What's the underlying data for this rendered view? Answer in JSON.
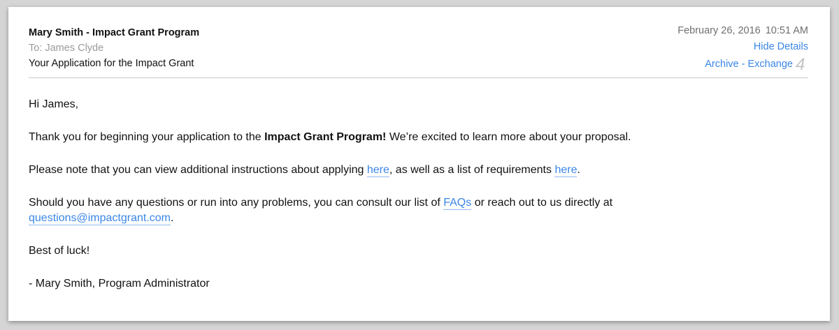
{
  "header": {
    "sender": "Mary Smith - Impact Grant Program",
    "to": "To: James Clyde",
    "subject": "Your Application for the Impact Grant",
    "date": "February 26, 2016",
    "time": "10:51 AM",
    "hide_details": "Hide Details",
    "mailbox": "Archive - Exchange",
    "count": "4"
  },
  "body": {
    "greeting": "Hi James,",
    "p1_pre": "Thank you for beginning your application to the ",
    "p1_bold": "Impact Grant Program!",
    "p1_post": " We’re excited to learn more about your proposal.",
    "p2_pre": "Please note that you can view additional instructions about applying ",
    "p2_link1": "here",
    "p2_mid": ", as well as a list of requirements ",
    "p2_link2": "here",
    "p2_post": ".",
    "p3_pre": "Should you have any questions or run into any problems, you can consult our list of ",
    "p3_link_faq": "FAQs",
    "p3_mid": " or reach out to us directly at",
    "p3_email": "questions@impactgrant.com",
    "p3_post": ".",
    "closing": "Best of luck!",
    "signature": "- Mary Smith, Program Administrator"
  },
  "colors": {
    "link": "#3a86e6",
    "muted": "#9a9a9a",
    "background": "#d5d5d5"
  }
}
